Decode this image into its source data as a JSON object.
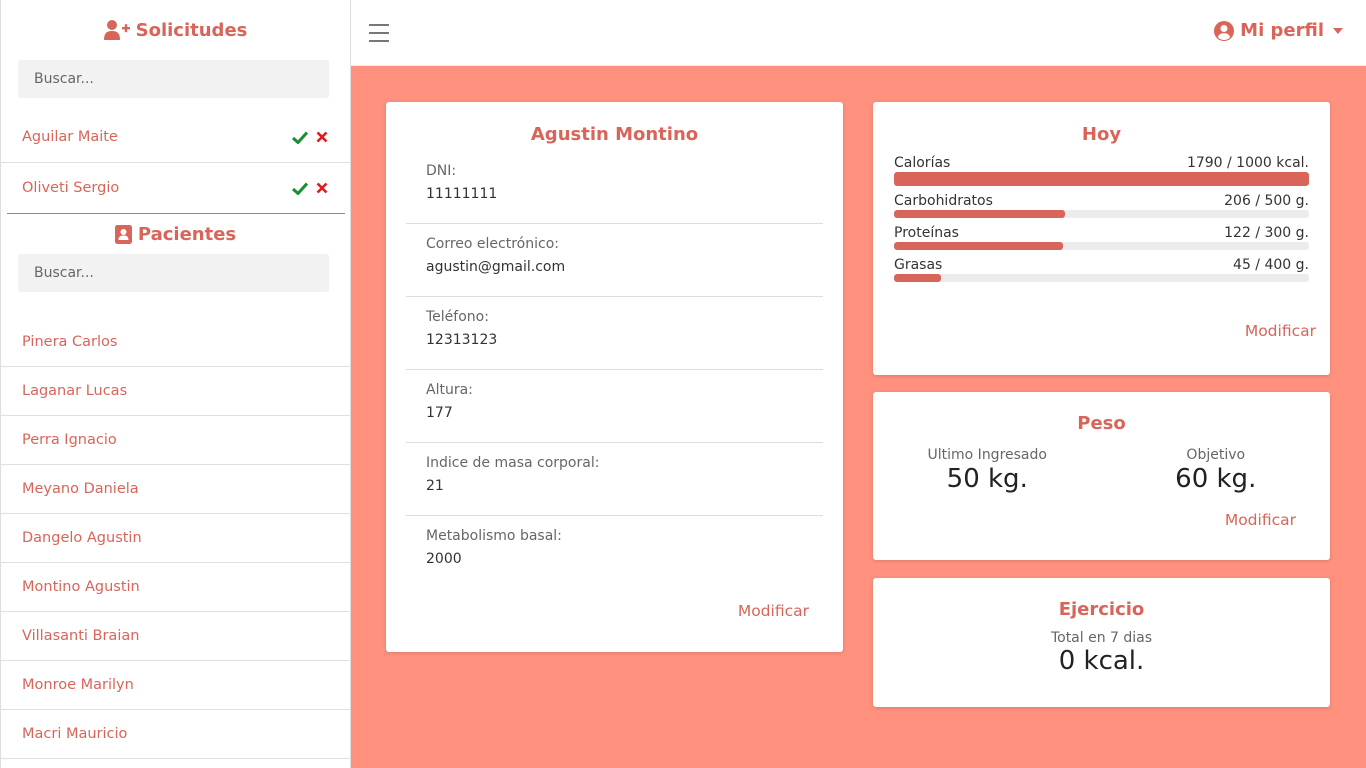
{
  "sidebar": {
    "requests_title": "Solicitudes",
    "requests_search_placeholder": "Buscar...",
    "requests": [
      {
        "name": "Aguilar Maite"
      },
      {
        "name": "Oliveti Sergio"
      }
    ],
    "patients_title": "Pacientes",
    "patients_search_placeholder": "Buscar...",
    "patients": [
      {
        "name": "Pinera Carlos"
      },
      {
        "name": "Laganar Lucas"
      },
      {
        "name": "Perra Ignacio"
      },
      {
        "name": "Meyano Daniela"
      },
      {
        "name": "Dangelo Agustin"
      },
      {
        "name": "Montino Agustin"
      },
      {
        "name": "Villasanti Braian"
      },
      {
        "name": "Monroe Marilyn"
      },
      {
        "name": "Macri Mauricio"
      }
    ]
  },
  "topbar": {
    "profile_label": "Mi perfil"
  },
  "patient": {
    "name": "Agustin Montino",
    "fields": [
      {
        "label": "DNI:",
        "value": "11111111"
      },
      {
        "label": "Correo electrónico:",
        "value": "agustin@gmail.com"
      },
      {
        "label": "Teléfono:",
        "value": "12313123"
      },
      {
        "label": "Altura:",
        "value": "177"
      },
      {
        "label": "Indice de masa corporal:",
        "value": "21"
      },
      {
        "label": "Metabolismo basal:",
        "value": "2000"
      }
    ],
    "modify_label": "Modificar"
  },
  "today": {
    "title": "Hoy",
    "items": [
      {
        "label": "Calorías",
        "value": "1790 / 1000 kcal.",
        "progress": 1.0
      },
      {
        "label": "Carbohidratos",
        "value": "206 / 500 g.",
        "progress": 0.412
      },
      {
        "label": "Proteínas",
        "value": "122 / 300 g.",
        "progress": 0.407
      },
      {
        "label": "Grasas",
        "value": "45 / 400 g.",
        "progress": 0.1125
      }
    ],
    "modify_label": "Modificar"
  },
  "weight": {
    "title": "Peso",
    "last_label": "Ultimo Ingresado",
    "last_value": "50 kg.",
    "goal_label": "Objetivo",
    "goal_value": "60 kg.",
    "modify_label": "Modificar"
  },
  "exercise": {
    "title": "Ejercicio",
    "label": "Total en 7 dias",
    "value": "0 kcal."
  },
  "colors": {
    "accent": "#d9655a",
    "background": "#ff917e",
    "accept": "#1a8f2e",
    "reject": "#e01b1b"
  }
}
